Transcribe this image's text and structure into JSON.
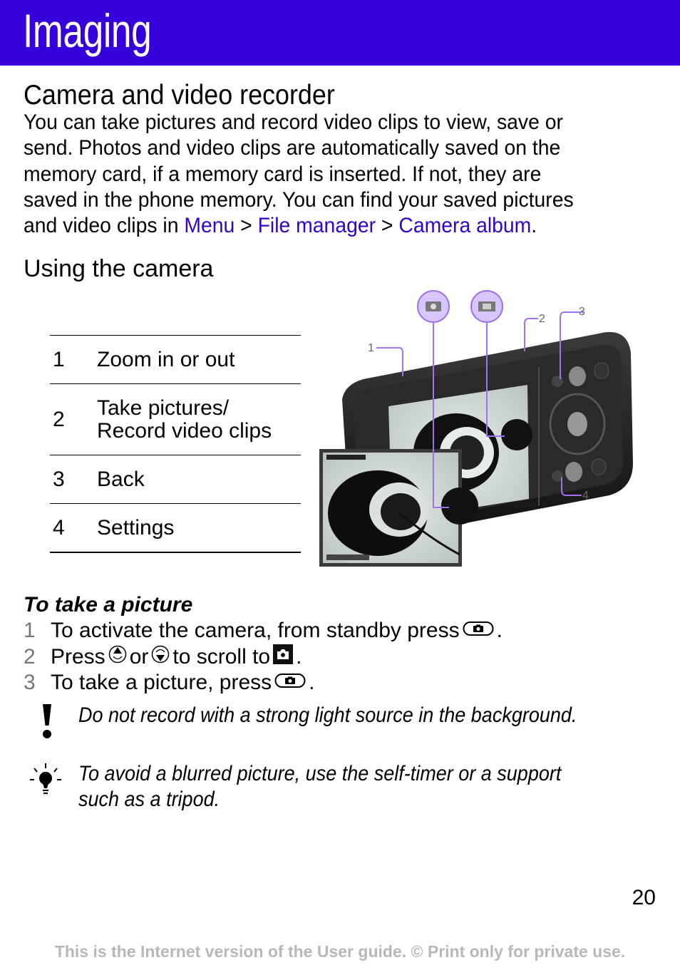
{
  "header": {
    "title": "Imaging"
  },
  "section": {
    "title": "Camera and video recorder",
    "intro_lines": [
      "You can take pictures and record video clips to view, save or",
      "send. Photos and video clips are automatically saved on the",
      "memory card, if a memory card is inserted. If not, they are",
      "saved in the phone memory. You can find your saved pictures"
    ],
    "intro_last_prefix": "and video clips in ",
    "path": {
      "menu": "Menu",
      "sep": " > ",
      "file_manager": "File manager",
      "camera_album": "Camera album",
      "end": "."
    }
  },
  "subsection": {
    "title": "Using the camera"
  },
  "legend": [
    {
      "num": "1",
      "label_lines": [
        "Zoom in or out"
      ]
    },
    {
      "num": "2",
      "label_lines": [
        "Take pictures/",
        "Record video clips"
      ]
    },
    {
      "num": "3",
      "label_lines": [
        "Back"
      ]
    },
    {
      "num": "4",
      "label_lines": [
        "Settings"
      ]
    }
  ],
  "illustration": {
    "callouts": [
      "1",
      "2",
      "3",
      "4"
    ],
    "mode_icons": [
      "camera-mode-icon",
      "video-mode-icon"
    ],
    "accent_color": "#a070f0"
  },
  "procedure": {
    "title": "To take a picture",
    "steps": [
      {
        "num": "1",
        "before": "To activate the camera, from standby press",
        "after": "."
      },
      {
        "num": "2",
        "before": "Press",
        "mid1": "or",
        "mid2": "to scroll to",
        "after": "."
      },
      {
        "num": "3",
        "before": "To take a picture, press",
        "after": "."
      }
    ]
  },
  "notes": [
    {
      "icon": "warning-icon",
      "lines": [
        "Do not record with a strong light source in the background."
      ]
    },
    {
      "icon": "tip-lightbulb-icon",
      "lines": [
        "To avoid a blurred picture, use the self-timer or a support",
        "such as a tripod."
      ]
    }
  ],
  "page_number": "20",
  "footer": "This is the Internet version of the User guide. © Print only for private use."
}
